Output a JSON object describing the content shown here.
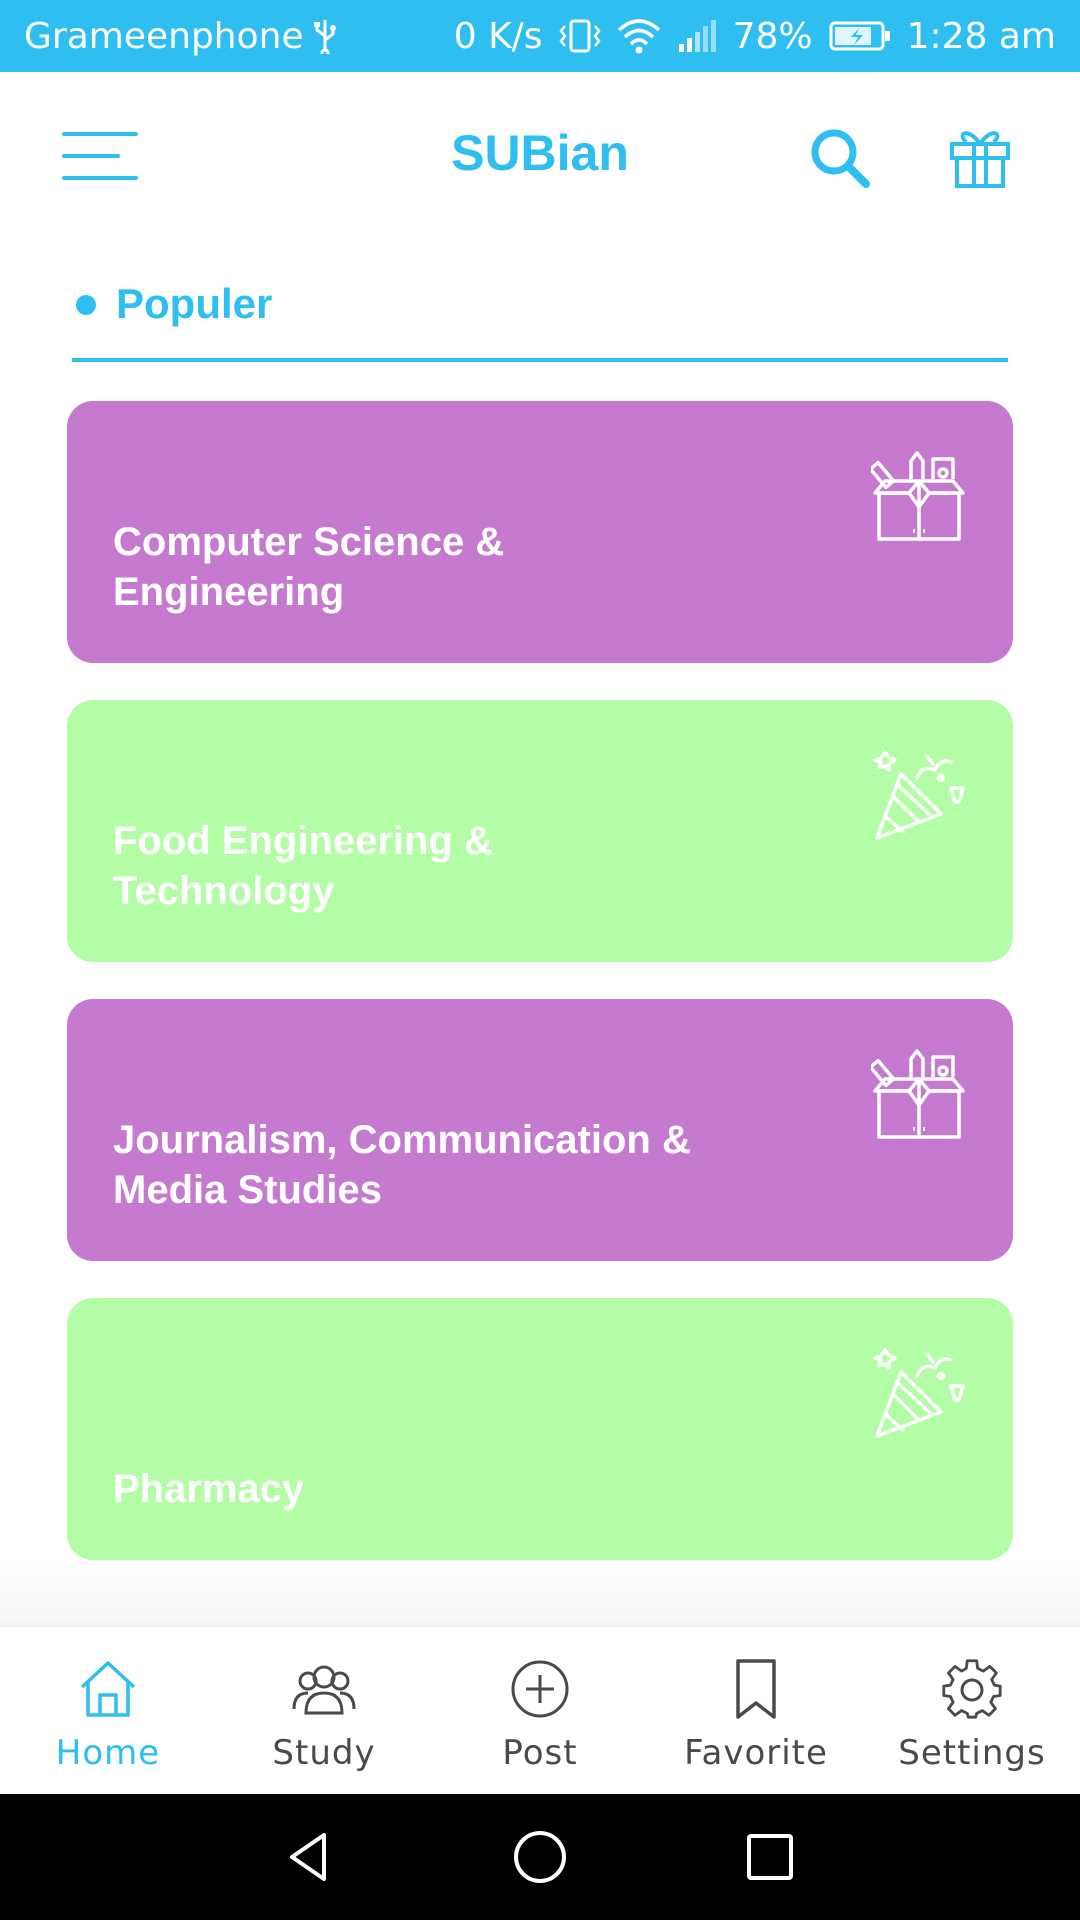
{
  "status_bar": {
    "carrier": "Grameenphone",
    "net_speed": "0 K/s",
    "battery": "78%",
    "time": "1:28 am"
  },
  "header": {
    "title": "SUBian",
    "menu_icon": "hamburger-menu-icon",
    "search_icon": "search-icon",
    "gift_icon": "gift-icon"
  },
  "section": {
    "title": "Populer"
  },
  "cards": [
    {
      "label": "Computer Science &\nEngineering",
      "color": "#c57acf",
      "icon": "toolbox-icon"
    },
    {
      "label": "Food Engineering &\nTechnology",
      "color": "#b3fda6",
      "icon": "party-popper-icon"
    },
    {
      "label": "Journalism, Communication &\nMedia Studies",
      "color": "#c57acf",
      "icon": "toolbox-icon"
    },
    {
      "label": "Pharmacy",
      "color": "#b3fda6",
      "icon": "party-popper-icon"
    }
  ],
  "bottom_nav": {
    "items": [
      {
        "label": "Home",
        "icon": "home-icon",
        "active": true
      },
      {
        "label": "Study",
        "icon": "group-icon",
        "active": false
      },
      {
        "label": "Post",
        "icon": "add-circle-icon",
        "active": false
      },
      {
        "label": "Favorite",
        "icon": "bookmark-icon",
        "active": false
      },
      {
        "label": "Settings",
        "icon": "gear-icon",
        "active": false
      }
    ]
  },
  "colors": {
    "accent": "#2fbef0",
    "purple_card": "#c57acf",
    "green_card": "#b3fda6"
  }
}
